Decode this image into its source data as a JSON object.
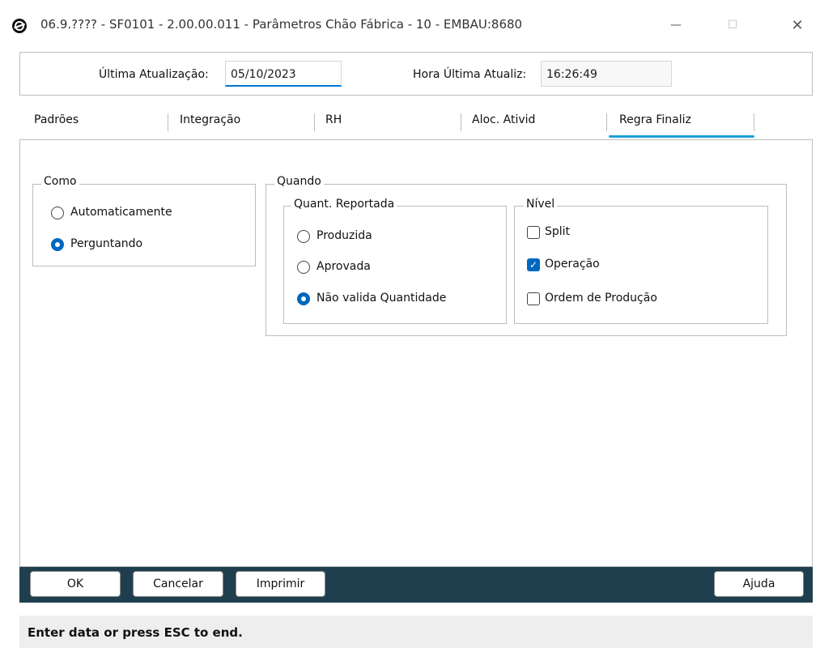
{
  "window": {
    "title": "06.9.???? - SF0101 - 2.00.00.011 - Parâmetros Chão Fábrica - 10 - EMBAU:8680",
    "minimize": "—",
    "maximize": "☐",
    "close": "✕"
  },
  "header": {
    "ultima_label": "Última Atualização:",
    "ultima_value": "05/10/2023",
    "hora_label": "Hora Última Atualiz:",
    "hora_value": "16:26:49"
  },
  "tabs": [
    {
      "label": "Padrões"
    },
    {
      "label": "Integração"
    },
    {
      "label": "RH"
    },
    {
      "label": "Aloc. Ativid"
    },
    {
      "label": "Regra Finaliz"
    }
  ],
  "active_tab": "Regra Finaliz",
  "como": {
    "title": "Como",
    "options": [
      {
        "label": "Automaticamente",
        "checked": false
      },
      {
        "label": "Perguntando",
        "checked": true
      }
    ]
  },
  "quando": {
    "title": "Quando",
    "quant": {
      "title": "Quant. Reportada",
      "options": [
        {
          "label": "Produzida",
          "checked": false
        },
        {
          "label": "Aprovada",
          "checked": false
        },
        {
          "label": "Não valida Quantidade",
          "checked": true
        }
      ]
    },
    "nivel": {
      "title": "Nível",
      "options": [
        {
          "label": "Split",
          "checked": false
        },
        {
          "label": "Operação",
          "checked": true
        },
        {
          "label": "Ordem de Produção",
          "checked": false
        }
      ]
    }
  },
  "buttons": {
    "ok": "OK",
    "cancelar": "Cancelar",
    "imprimir": "Imprimir",
    "ajuda": "Ajuda"
  },
  "status": "Enter data or press ESC to end.",
  "colors": {
    "accent": "#0067c0",
    "tab_underline": "#1ba1d9",
    "footer_bar": "#1f3f4f"
  }
}
